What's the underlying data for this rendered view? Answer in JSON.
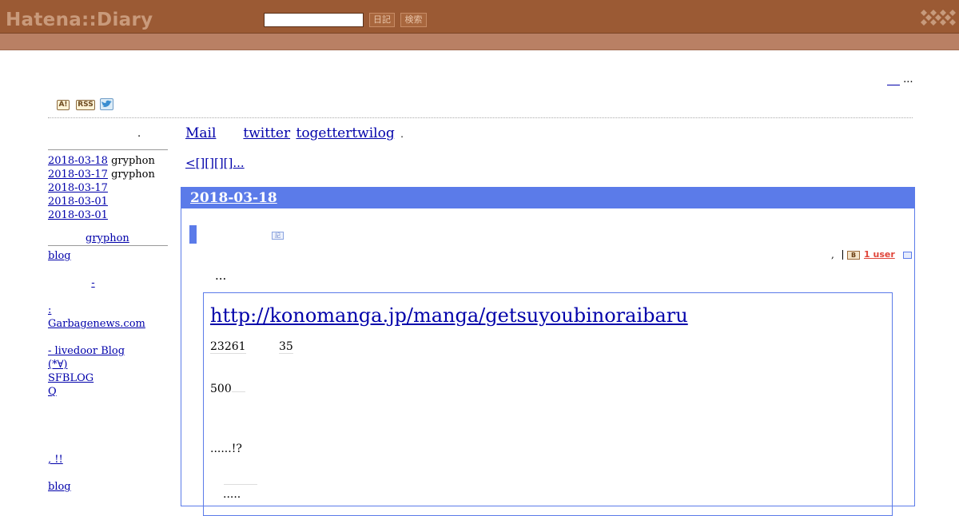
{
  "header": {
    "logo": "Hatena::Diary",
    "search_placeholder": "",
    "diary_button": "日記",
    "search_button": "検索"
  },
  "top_right": {
    "text": "..."
  },
  "icons": {
    "antenna": "A!",
    "rss": "RSS",
    "twitter": "twitter-bird-icon"
  },
  "sidebar": {
    "dot": ".",
    "recent": [
      {
        "date": "2018-03-18",
        "author": "gryphon"
      },
      {
        "date": "2018-03-17",
        "author": "gryphon"
      },
      {
        "date": "2018-03-17",
        "author": ""
      },
      {
        "date": "2018-03-01",
        "author": ""
      },
      {
        "date": "2018-03-01",
        "author": ""
      }
    ],
    "gryphon_label": "gryphon",
    "links": [
      "blog",
      "",
      "-",
      "",
      ":",
      "Garbagenews.com",
      "",
      " - livedoor Blog",
      "(*∀)",
      "SFBLOG",
      "Q",
      "",
      "",
      "",
      "",
      ", !!",
      "",
      "blog"
    ]
  },
  "main": {
    "nav": [
      {
        "label": "Mail"
      },
      {
        "label": "twitter"
      },
      {
        "label": "togettertwilog"
      }
    ],
    "nav_dot": ".",
    "pager": "<[][][][]...",
    "entry": {
      "date": "2018-03-18",
      "section_icon": "記",
      "tools_comma": ",",
      "hatebu_icon": "B",
      "hatebu_users": "1 user",
      "ellipsis": "...",
      "quote": {
        "url": "http://konomanga.jp/manga/getsuyoubinoraibaru",
        "num1": "23261",
        "num2": "35",
        "line_500": "500",
        "line_exclaim": "......!?",
        "line_dots": "....."
      }
    }
  },
  "colors": {
    "header_bar": "#9b5a34",
    "sub_bar": "#b98064",
    "accent_blue": "#5b7be9",
    "link": "#0000aa"
  }
}
